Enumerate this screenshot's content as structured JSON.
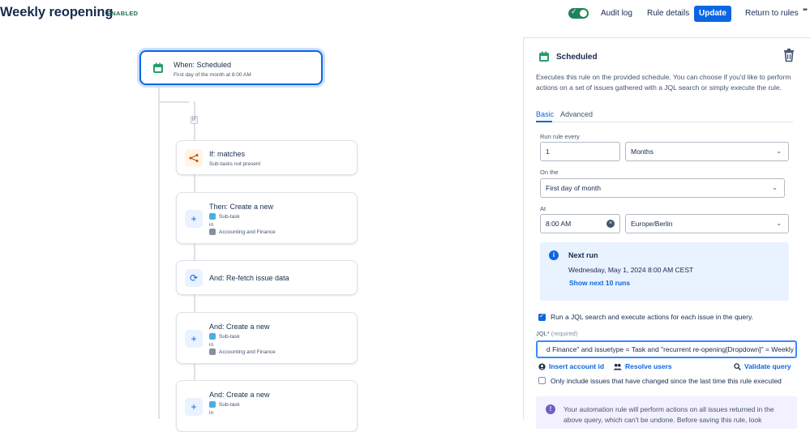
{
  "header": {
    "title": "Weekly reopening",
    "status_badge": "ENABLED",
    "audit_log": "Audit log",
    "rule_details": "Rule details",
    "update": "Update",
    "return_to_rules": "Return to rules",
    "more": "••"
  },
  "colors": {
    "accent": "#0c66e4",
    "toggle_on": "#1f845a",
    "badge": "#216e4e"
  },
  "flow": {
    "if_marker": "IF",
    "trigger": {
      "title": "When: Scheduled",
      "subtitle": "First day of the month at 8:00 AM",
      "icon": "calendar-icon"
    },
    "condition": {
      "title": "If: matches",
      "subtitle": "Sub-tasks not present",
      "icon": "branch-icon"
    },
    "action1": {
      "title": "Then: Create a new",
      "issue_type": "Sub-task",
      "in_label": "in",
      "project": "Accounting and Finance",
      "icon": "plus-icon"
    },
    "action2": {
      "title": "And: Re-fetch issue data",
      "icon": "refresh-icon"
    },
    "action3": {
      "title": "And: Create a new",
      "issue_type": "Sub-task",
      "in_label": "in",
      "project": "Accounting and Finance",
      "icon": "plus-icon"
    },
    "action4": {
      "title": "And: Create a new",
      "issue_type": "Sub-task",
      "in_label": "in",
      "icon": "plus-icon"
    }
  },
  "panel": {
    "title": "Scheduled",
    "description": "Executes this rule on the provided schedule. You can choose if you'd like to perform actions on a set of issues gathered with a JQL search or simply execute the rule.",
    "tabs": [
      "Basic",
      "Advanced"
    ],
    "run_every_label": "Run rule every",
    "run_every_value": "1",
    "run_every_unit": "Months",
    "on_the_label": "On the",
    "on_the_value": "First day of month",
    "at_label": "At",
    "at_time": "8:00 AM",
    "timezone": "Europe/Berlin",
    "next_run": {
      "heading": "Next run",
      "date": "Wednesday, May 1, 2024 8:00 AM CEST",
      "show_more": "Show next 10 runs"
    },
    "jql_checkbox": "Run a JQL search and execute actions for each issue in the query.",
    "jql_label": "JQL*",
    "jql_required": "(required)",
    "jql_value": "d Finance\" and issuetype = Task and \"recurrent re-opening[Dropdown]\" = Weekly",
    "insert_account": "Insert account id",
    "resolve_users": "Resolve users",
    "validate_query": "Validate query",
    "only_changed": "Only include issues that have changed since the last time this rule executed",
    "warning": "Your automation rule will perform actions on all issues returned in the above query, which can't be undone. Before saving this rule, look"
  }
}
